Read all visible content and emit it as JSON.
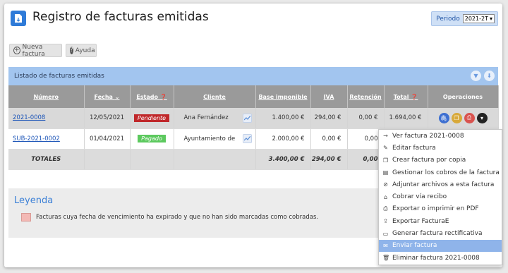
{
  "header": {
    "title": "Registro de facturas emitidas",
    "period_label": "Periodo",
    "period_value": "2021-2T"
  },
  "toolbar": {
    "new_invoice": "Nueva factura",
    "help": "Ayuda"
  },
  "listing": {
    "title": "Listado de facturas emitidas"
  },
  "table": {
    "columns": [
      "Número",
      "Fecha",
      "Estado",
      "Cliente",
      "Base imponible",
      "IVA",
      "Retención",
      "Total",
      "Operaciones"
    ],
    "rows": [
      {
        "numero": "2021-0008",
        "fecha": "12/05/2021",
        "estado": "Pendiente",
        "cliente": "Ana Fernández",
        "base": "1.400,00 €",
        "iva": "294,00 €",
        "retencion": "0,00 €",
        "total": "1.694,00 €"
      },
      {
        "numero": "SUB-2021-0002",
        "fecha": "01/04/2021",
        "estado": "Pagado",
        "cliente": "Ayuntamiento de",
        "base": "2.000,00 €",
        "iva": "0,00 €",
        "retencion": "0,00"
      }
    ],
    "totals": {
      "label": "TOTALES",
      "base": "3.400,00 €",
      "iva": "294,00 €",
      "retencion": "0,00"
    }
  },
  "legend": {
    "title": "Leyenda",
    "text": "Facturas cuya fecha de vencimiento ha expirado y que no han sido marcadas como cobradas."
  },
  "menu": {
    "items": [
      {
        "icon": "arrow-right-icon",
        "label": "Ver factura 2021-0008"
      },
      {
        "icon": "pencil-icon",
        "label": "Editar factura"
      },
      {
        "icon": "copy-icon",
        "label": "Crear factura por copia"
      },
      {
        "icon": "payments-icon",
        "label": "Gestionar los cobros de la factura"
      },
      {
        "icon": "paperclip-icon",
        "label": "Adjuntar archivos a esta factura"
      },
      {
        "icon": "bank-icon",
        "label": "Cobrar vía recibo"
      },
      {
        "icon": "print-icon",
        "label": "Exportar o imprimir en PDF"
      },
      {
        "icon": "export-icon",
        "label": "Exportar FacturaE"
      },
      {
        "icon": "document-icon",
        "label": "Generar factura rectificativa"
      },
      {
        "icon": "envelope-icon",
        "label": "Enviar factura"
      },
      {
        "icon": "trash-icon",
        "label": "Eliminar factura 2021-0008"
      }
    ],
    "highlighted": "Enviar factura"
  },
  "colors": {
    "accent": "#2f7bd8",
    "pending": "#c0282b",
    "paid": "#5cc95e",
    "bar": "#a2c5ef",
    "header": "#9a9a9a"
  }
}
